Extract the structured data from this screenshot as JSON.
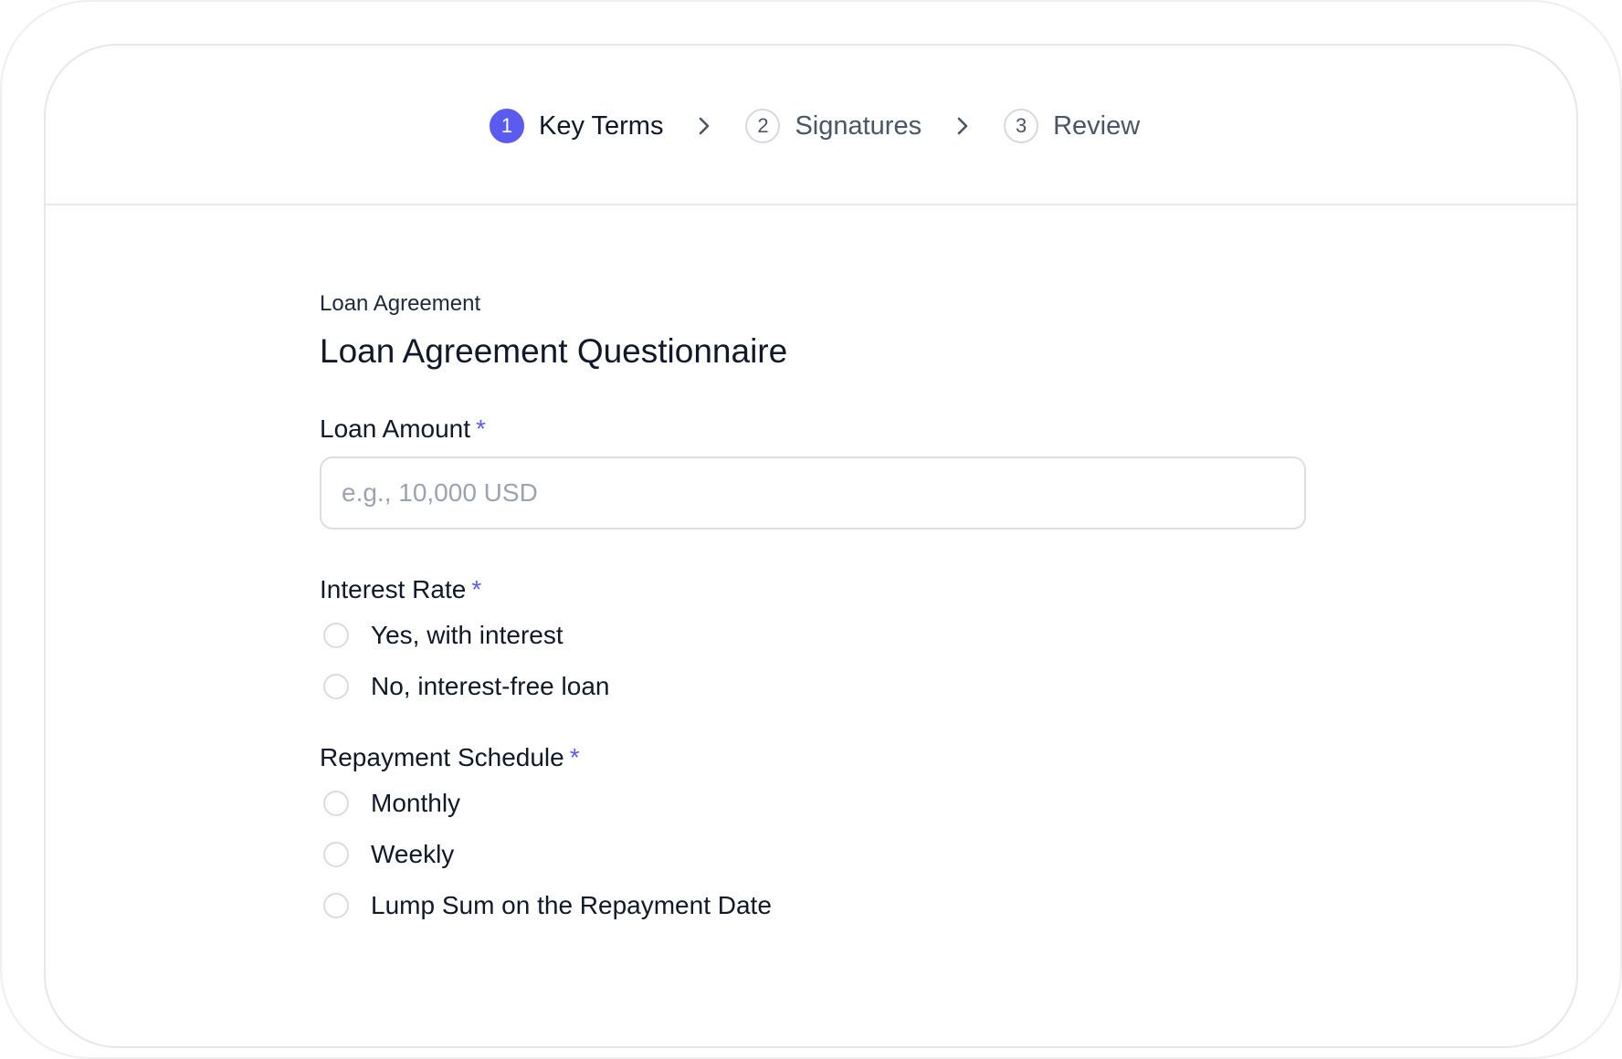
{
  "stepper": {
    "steps": [
      {
        "number": "1",
        "label": "Key Terms",
        "active": true
      },
      {
        "number": "2",
        "label": "Signatures",
        "active": false
      },
      {
        "number": "3",
        "label": "Review",
        "active": false
      }
    ]
  },
  "form": {
    "doc_type": "Loan Agreement",
    "title": "Loan Agreement Questionnaire",
    "required_marker": "*",
    "loan_amount": {
      "label": "Loan Amount",
      "placeholder": "e.g., 10,000 USD",
      "value": ""
    },
    "interest_rate": {
      "label": "Interest Rate",
      "options": [
        "Yes, with interest",
        "No, interest-free loan"
      ]
    },
    "repayment_schedule": {
      "label": "Repayment Schedule",
      "options": [
        "Monthly",
        "Weekly",
        "Lump Sum on the Repayment Date"
      ]
    }
  },
  "colors": {
    "accent": "#5b5bf0",
    "border": "#e6e7ea",
    "text": "#111827",
    "muted": "#4b5563",
    "placeholder": "#9ca3af"
  },
  "icons": {
    "step_separator": "chevron-right-icon",
    "radio": "radio-unchecked-icon"
  }
}
